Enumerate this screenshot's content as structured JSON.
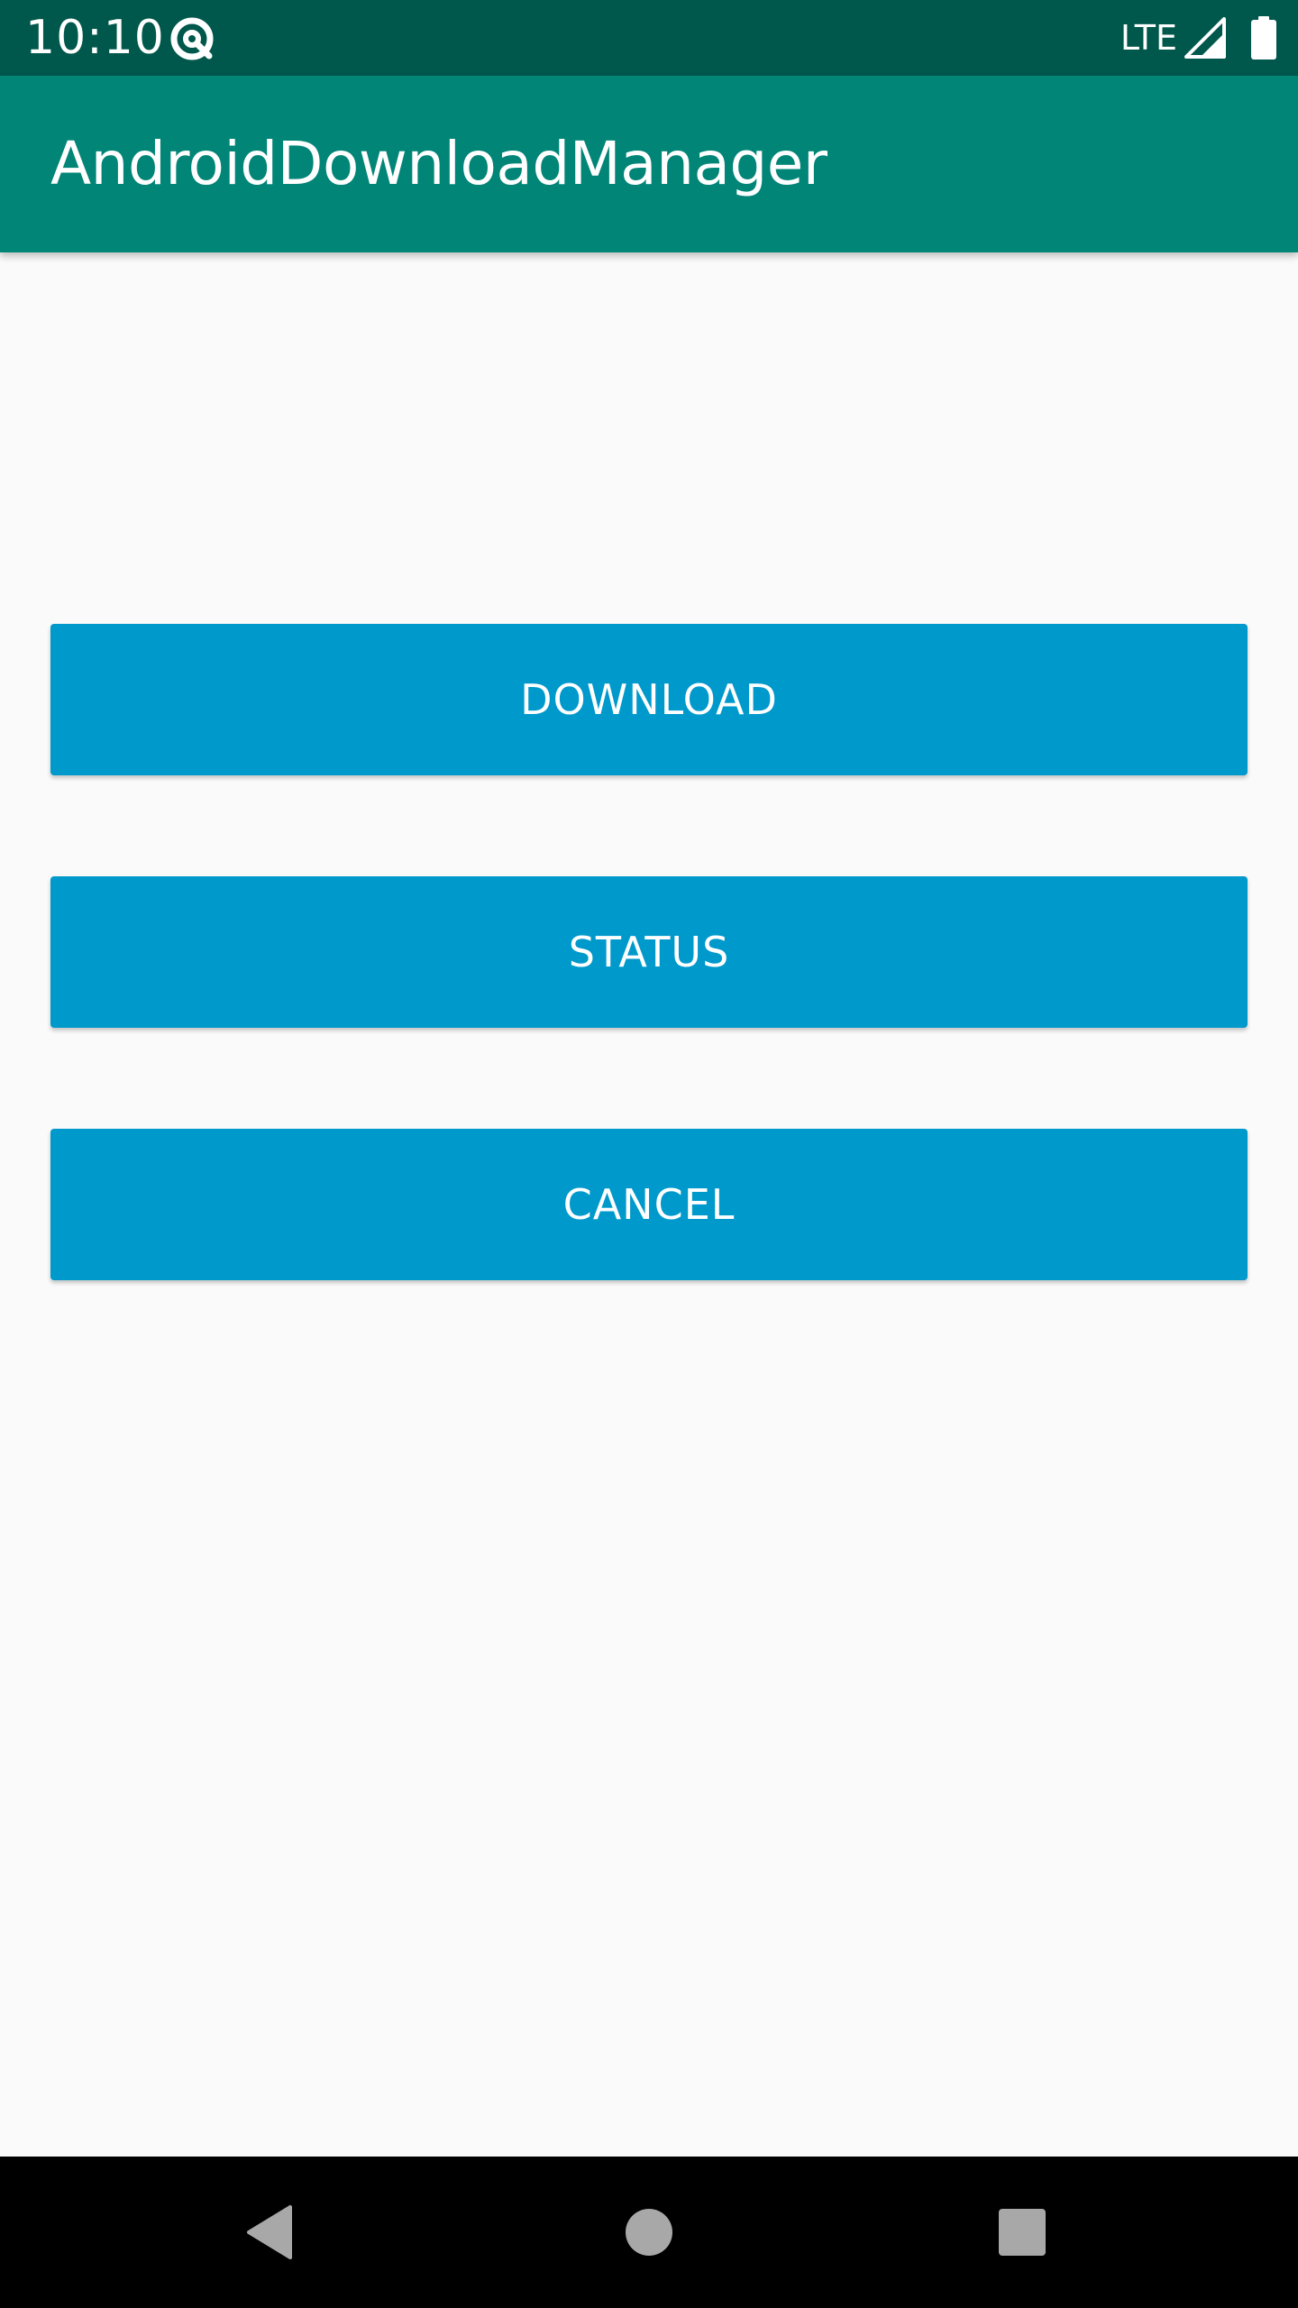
{
  "status_bar": {
    "time": "10:10",
    "app_icon": "at-sign-icon",
    "network": "LTE",
    "signal_icon": "cell-signal-icon",
    "battery_icon": "battery-full-icon",
    "background": "#00574b"
  },
  "app_bar": {
    "title": "AndroidDownloadManager",
    "background": "#008577"
  },
  "buttons": {
    "download_label": "DOWNLOAD",
    "status_label": "STATUS",
    "cancel_label": "CANCEL",
    "color": "#0099cc"
  },
  "nav_bar": {
    "back_icon": "back-triangle-icon",
    "home_icon": "home-circle-icon",
    "recents_icon": "recents-square-icon"
  }
}
